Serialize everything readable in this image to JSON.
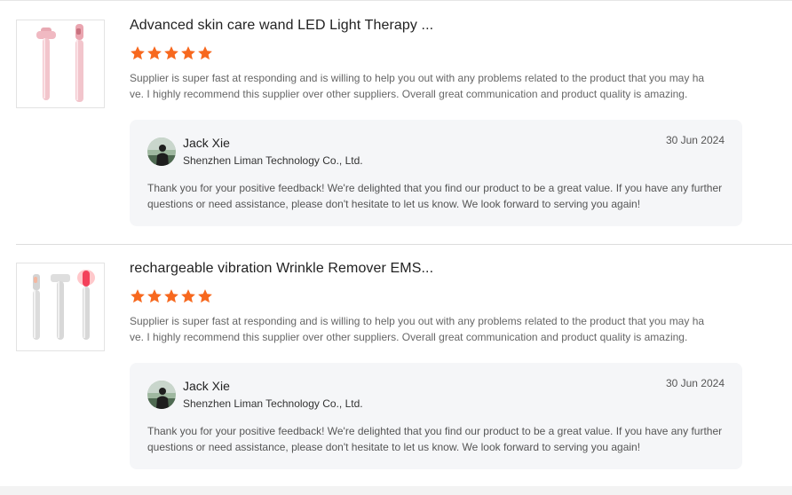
{
  "reviews": [
    {
      "product_title": "Advanced skin care wand LED Light Therapy ...",
      "rating": 5,
      "rating_max": 5,
      "review_text": "Supplier is super fast at responding and is willing to help you out with any problems related to the product that you may have. I highly recommend this supplier over other suppliers. Overall great communication and product quality is amazing.",
      "product_icon": "pink-skin-care-wand-image",
      "reply": {
        "name": "Jack Xie",
        "company": "Shenzhen Liman Technology Co., Ltd.",
        "date": "30 Jun 2024",
        "text": "Thank you for your positive feedback! We're delighted that you find our product to be a great value. If you have any further questions or need assistance, please don't hesitate to let us know. We look forward to serving you again!"
      }
    },
    {
      "product_title": "rechargeable vibration Wrinkle Remover EMS...",
      "rating": 5,
      "rating_max": 5,
      "review_text": "Supplier is super fast at responding and is willing to help you out with any problems related to the product that you may have. I highly recommend this supplier over other suppliers. Overall great communication and product quality is amazing.",
      "product_icon": "silver-wrinkle-remover-wands-image",
      "reply": {
        "name": "Jack Xie",
        "company": "Shenzhen Liman Technology Co., Ltd.",
        "date": "30 Jun 2024",
        "text": "Thank you for your positive feedback! We're delighted that you find our product to be a great value. If you have any further questions or need assistance, please don't hesitate to let us know. We look forward to serving you again!"
      }
    }
  ],
  "colors": {
    "star": "#f7681e",
    "reply_bg": "#f5f6f8",
    "muted_text": "#666666"
  }
}
